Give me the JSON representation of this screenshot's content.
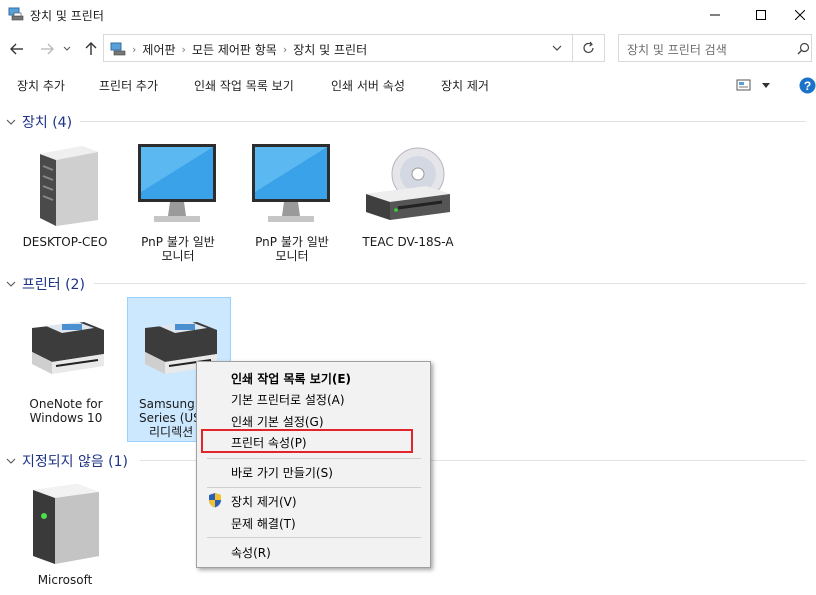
{
  "window": {
    "title": "장치 및 프린터"
  },
  "address": {
    "crumbs": [
      "제어판",
      "모든 제어판 항목",
      "장치 및 프린터"
    ]
  },
  "search": {
    "placeholder": "장치 및 프린터 검색"
  },
  "commands": [
    "장치 추가",
    "프린터 추가",
    "인쇄 작업 목록 보기",
    "인쇄 서버 속성",
    "장치 제거"
  ],
  "groups": {
    "devices": {
      "title": "장치 (4)"
    },
    "printers": {
      "title": "프린터 (2)"
    },
    "unspecified": {
      "title": "지정되지 않음 (1)"
    }
  },
  "devices": [
    {
      "line1": "DESKTOP-CEO",
      "line2": ""
    },
    {
      "line1": "PnP 불가 일반",
      "line2": "모니터"
    },
    {
      "line1": "PnP 불가 일반",
      "line2": "모니터"
    },
    {
      "line1": "TEAC DV-18S-A",
      "line2": ""
    }
  ],
  "printers": [
    {
      "line1": "OneNote for",
      "line2": "Windows 10",
      "line3": ""
    },
    {
      "line1": "Samsung C",
      "line2": "Series (USB",
      "line3": "리디렉션"
    }
  ],
  "unspecified": [
    {
      "line1": "Microsoft"
    }
  ],
  "context_menu": {
    "items": [
      "인쇄 작업 목록 보기(E)",
      "기본 프린터로 설정(A)",
      "인쇄 기본 설정(G)",
      "프린터 속성(P)",
      "바로 가기 만들기(S)",
      "장치 제거(V)",
      "문제 해결(T)",
      "속성(R)"
    ],
    "highlighted": "프린터 속성(P)"
  },
  "colors": {
    "accent": "#1e3287",
    "selection": "#cce8ff",
    "highlight_box": "#e0252b",
    "help": "#1a73c8"
  }
}
